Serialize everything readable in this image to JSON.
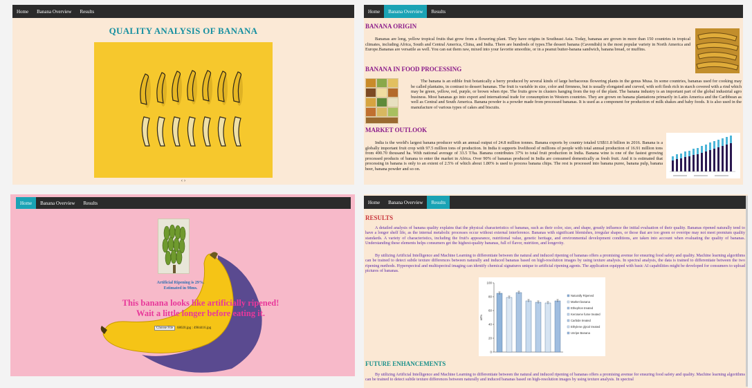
{
  "nav": {
    "home": "Home",
    "overview": "Banana Overview",
    "results": "Results"
  },
  "home": {
    "title": "QUALITY ANALYSIS OF BANANA",
    "carousel_arrows": "‹ ›"
  },
  "overview": {
    "origin_title": "BANANA ORIGIN",
    "origin_text": "Bananas are long, yellow tropical fruits that grow from a flowering plant. They have origins in Southeast Asia. Today, bananas are grown in more than 150 countries in tropical climates, including Africa, South and Central America, China, and India. There are hundreds of types.The dessert banana (Cavendish) is the most popular variety in North America and Europe.Bananas are versatile as well. You can eat them raw, mixed into your favorite smoothie, or in a peanut butter-banana sandwich, banana bread, or muffins.",
    "processing_title": "BANANA IN FOOD PROCESSING",
    "processing_text": "The banana is an edible fruit botanically a berry produced by several kinds of large herbaceous flowering plants in the genus Musa. In some countries, bananas used for cooking may be called plantains, in contrast to dessert bananas. The fruit is variable in size, color and firmness, but is usually elongated and curved, with soft flesh rich in starch covered with a rind which may be green, yellow, red, purple, or brown when ripe. The fruits grow in clusters hanging from the top of the plant. The banana industry is an important part of the global industrial agro business. Most bananas go into export and international trade for consumption in Western countries. They are grown on banana plantations primarily in Latin America and the Caribbean as well as Central and South America. Banana powder is a powder made from processed bananas. It is used as a component for production of milk shakes and baby foods. It is also used in the manufacture of various types of cakes and biscuits.",
    "market_title": "MARKET OUTLOOK",
    "market_text": "India is the world's largest banana producer with an annual output of 24.8 million tonnes. Banana exports by country totaled US$11.8 billion in 2016. Banana is a globally important fruit crop with 97.5 million tons of production. In India it supports livelihood of millions of people with total annual production of 16.91 million tons from 490.70 thousand ha. With national average of 33.5 T/ha. Banana contributes 37% to total fruit production in India. Banana wine is one of the fastest growing processed products of banana to enter the market in Africa. Over 90% of bananas produced in India are consumed domestically as fresh fruit. And it is estimated that processing in banana is only to an extent of 2.5% of which about 1.80% is used to process banana chips. The rest is processed into banana puree, banana pulp, banana beer, banana powder and so on."
  },
  "detect": {
    "status_line1": "Artificial Ripening is 29%.",
    "status_line2": "Estimated in 98ms.",
    "message_line1": "This banana looks like artificially ripened!",
    "message_line2": "Wait a little longer before eating it.",
    "choose_file": "Choose File",
    "file_name": "68020.jpg : 4984416.jpg"
  },
  "results": {
    "results_title": "RESULTS",
    "results_p1": "A detailed analysis of banana quality explains that the physical characteristics of bananas, such as their color, size, and shape, greatly influence the initial evaluation of their quality. Bananas ripened naturally tend to have a longer shelf life, as the internal metabolic processes occur without external interference. Bananas with significant blemishes, irregular shapes, or those that are too green or overripe may not meet premium quality standards. A variety of characteristics, including the fruit's appearance, nutritional value, genetic heritage, and environmental development conditions, are taken into account when evaluating the quality of bananas. Understanding these elements helps consumers get the highest-quality bananas, full of flavor, nutrition, and longevity.",
    "results_p2": "By utilizing Artificial Intelligence and Machine Learning to differentiate between the natural and induced ripening of bananas offers a promising avenue for ensuring food safety and quality. Machine learning algorithms can be trained to detect subtle texture differences between naturally and induced bananas based on high-resolution images by using texture analysis. In spectral analysis, the data is trained to differentiate between the two ripening methods. Hyperspectral and multispectral imaging can identify chemical signatures unique to artificial ripening agents. The application equipped with basic AI capabilities might be developed for consumers to upload pictures of bananas.",
    "future_title": "FUTURE ENHANCEMENTS",
    "future_p1": "By utilizing Artificial Intelligence and Machine Learning to differentiate between the natural and induced ripening of bananas offers a promising avenue for ensuring food safety and quality. Machine learning algorithms can be trained to detect subtle texture differences between naturally and induced bananas based on high-resolution images by using texture analysis. In spectral"
  },
  "chart_data": {
    "type": "bar",
    "ylabel": "wt%",
    "ylim": [
      0,
      100
    ],
    "yticks": [
      0,
      20,
      40,
      60,
      80,
      100
    ],
    "categories": [
      "Naturally Ripened",
      "Market banana",
      "Ethephon treated",
      "Kerosene fume treated",
      "Carbide treated",
      "Ethylene glycol treated",
      "Unripe Banana"
    ],
    "values": [
      85,
      79,
      86,
      74,
      72,
      71,
      74
    ]
  },
  "colors": {
    "nav": "#2b2b2b",
    "active_tab": "#1aa3b5",
    "title_teal": "#168fa0",
    "heading_purple": "#8a1a8a",
    "result_red": "#c8353b",
    "future_teal": "#178f8a",
    "message_pink": "#e8389a"
  }
}
